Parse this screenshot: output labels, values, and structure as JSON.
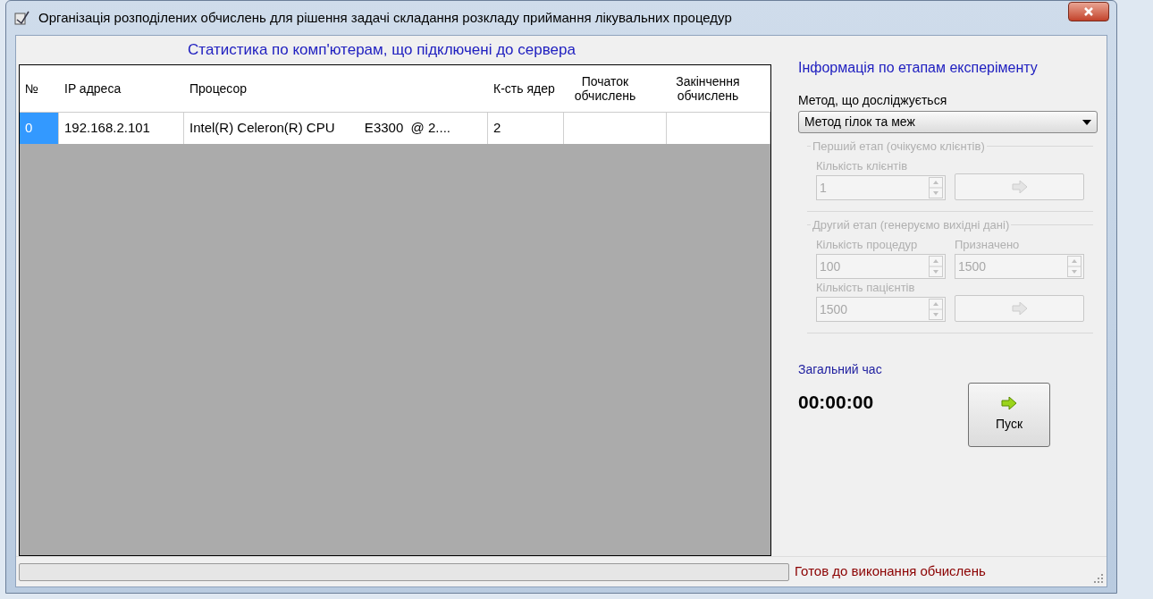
{
  "window": {
    "title": "Організація розподілених обчислень для рішення задачі складання розкладу приймання лікувальних процедур"
  },
  "computers_panel": {
    "heading": "Статистика по комп'ютерам, що підключені до сервера",
    "table": {
      "columns": [
        "№",
        "IP адреса",
        "Процесор",
        "К-сть ядер",
        "Початок обчислень",
        "Закінчення обчислень"
      ],
      "rows": [
        {
          "cells": [
            {
              "text": "0",
              "selected": true
            },
            {
              "text": "192.168.2.101",
              "selected": false
            },
            {
              "text": "Intel(R) Celeron(R) CPU        E3300  @ 2....",
              "selected": false
            },
            {
              "text": "2",
              "selected": false
            }
          ]
        }
      ]
    }
  },
  "experiment_panel": {
    "heading": "Інформація по етапам експеріменту",
    "method_label": "Метод, що досліджується",
    "method_value": "Метод гілок та меж",
    "stages": [
      {
        "legend": "Перший етап (очікуємо клієнтів)",
        "disabled": true,
        "fields": [
          {
            "label": "Кількість клієнтів",
            "value": "1"
          }
        ],
        "has_next_button": true
      },
      {
        "legend": "Другий етап (генеруємо вихідні дані)",
        "disabled": true,
        "fields": [
          {
            "label": "Кількість процедур",
            "value": "100"
          },
          {
            "label": "Призначено",
            "value": "1500"
          },
          {
            "label": "Кількість пацієнтів",
            "value": "1500"
          }
        ],
        "has_next_button": true
      }
    ],
    "total_time_label": "Загальний час",
    "total_time": "00:00:00",
    "start_button": "Пуск"
  },
  "status_bar": {
    "progress": {
      "level": 0
    },
    "text": "Готов до виконання обчислень"
  }
}
